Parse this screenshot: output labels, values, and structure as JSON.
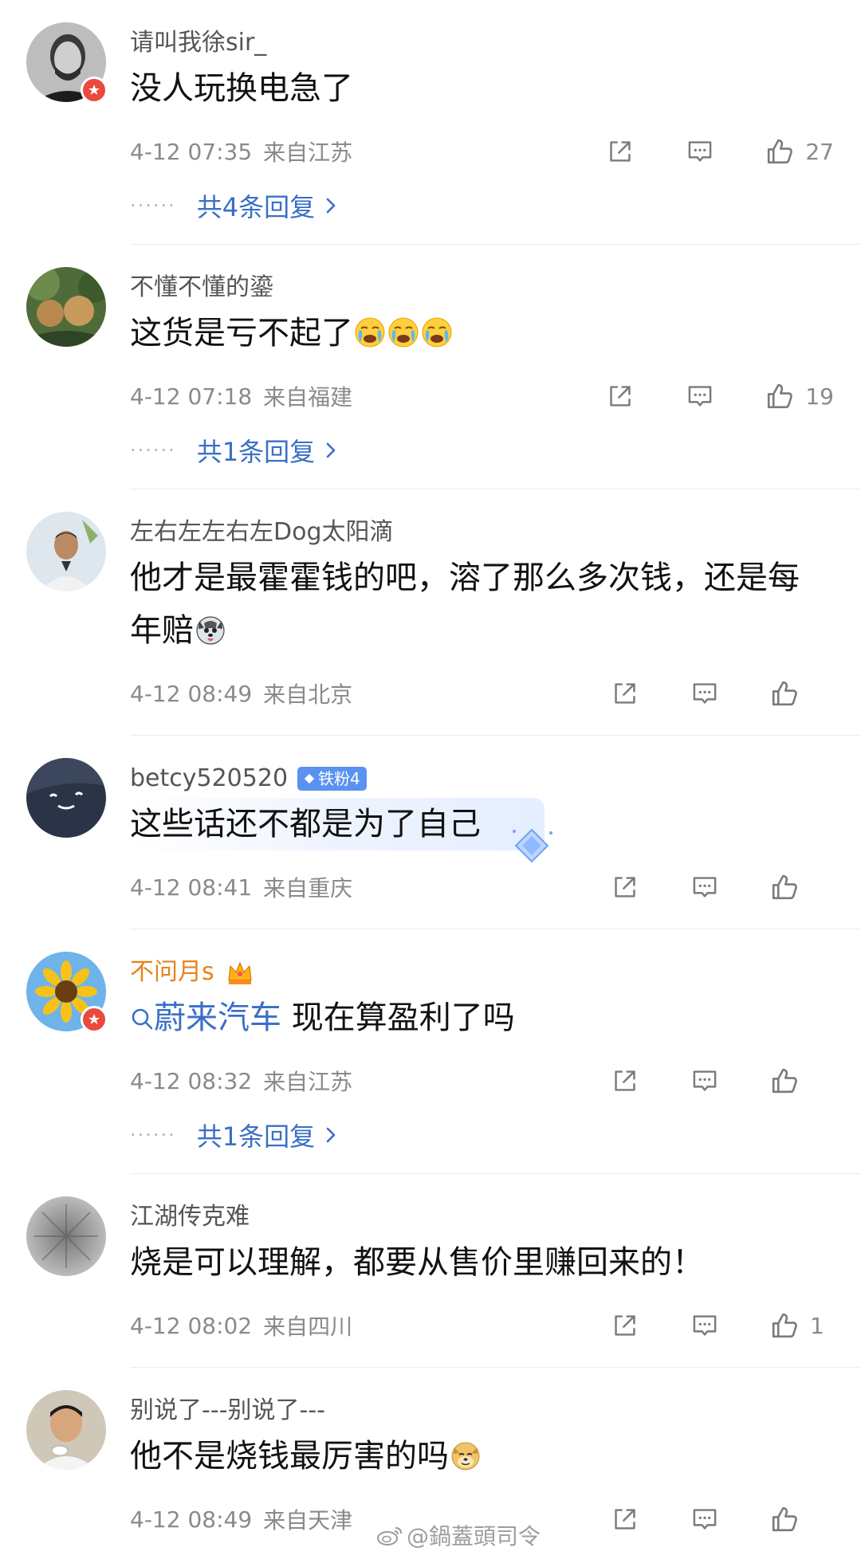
{
  "colors": {
    "link": "#3a6fc6",
    "meta": "#8a8a8a",
    "vip_name": "#e8821a",
    "badge_red": "#e94a3b",
    "fan_badge": "#5a92f0"
  },
  "icons": {
    "share": "share-icon",
    "comment": "comment-icon",
    "like": "thumbs-up-icon"
  },
  "comments": [
    {
      "username": "请叫我徐sir_",
      "content": "没人玩换电急了",
      "time": "4-12 07:35",
      "location": "来自江苏",
      "likes": "27",
      "replies": "共4条回复"
    },
    {
      "username": "不懂不懂的鎏",
      "content": "这货是亏不起了",
      "time": "4-12 07:18",
      "location": "来自福建",
      "likes": "19",
      "replies": "共1条回复"
    },
    {
      "username": "左右左左右左Dog太阳滴",
      "content": "他才是最霍霍钱的吧，溶了那么多次钱，还是每年赔",
      "time": "4-12 08:49",
      "location": "来自北京",
      "likes": ""
    },
    {
      "username": "betcy520520",
      "badge": "铁粉4",
      "content": "这些话还不都是为了自己",
      "time": "4-12 08:41",
      "location": "来自重庆",
      "likes": ""
    },
    {
      "username": "不问月s",
      "topic": "蔚来汽车",
      "content": " 现在算盈利了吗",
      "time": "4-12 08:32",
      "location": "来自江苏",
      "likes": "",
      "replies": "共1条回复"
    },
    {
      "username": "江湖传克难",
      "content": "烧是可以理解，都要从售价里赚回来的！",
      "time": "4-12 08:02",
      "location": "来自四川",
      "likes": "1"
    },
    {
      "username": "别说了---别说了---",
      "content": "他不是烧钱最厉害的吗",
      "time": "4-12 08:49",
      "location": "来自天津",
      "likes": ""
    }
  ],
  "watermark": "@鍋蓋頭司令"
}
